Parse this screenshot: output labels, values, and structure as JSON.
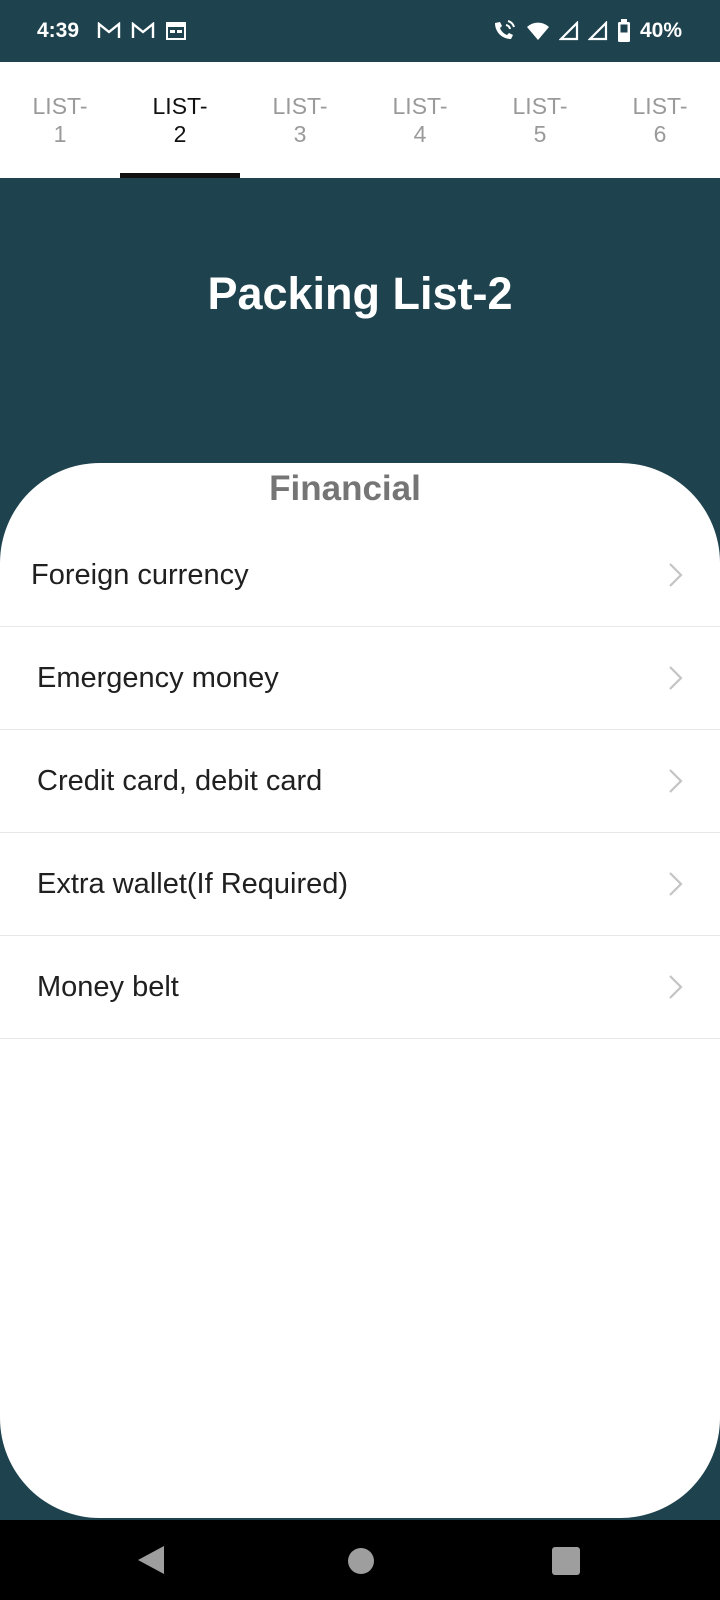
{
  "status_bar": {
    "time": "4:39",
    "notification_icons": [
      "gmail-icon",
      "gmail-icon",
      "calendar-icon"
    ],
    "system_icons": [
      "wifi-calling-icon",
      "wifi-icon",
      "signal-icon",
      "signal-icon",
      "battery-icon"
    ],
    "battery": "40%"
  },
  "tabs": [
    {
      "label": "LIST-1",
      "active": false
    },
    {
      "label": "LIST-2",
      "active": true
    },
    {
      "label": "LIST-3",
      "active": false
    },
    {
      "label": "LIST-4",
      "active": false
    },
    {
      "label": "LIST-5",
      "active": false
    },
    {
      "label": "LIST-6",
      "active": false
    }
  ],
  "header": {
    "title": "Packing List-2"
  },
  "section": {
    "title": "Financial",
    "items": [
      {
        "label": "Foreign currency"
      },
      {
        "label": "Emergency money"
      },
      {
        "label": "Credit card, debit card"
      },
      {
        "label": "Extra wallet(If Required)"
      },
      {
        "label": "Money belt"
      }
    ]
  },
  "nav_bar": {
    "buttons": [
      "back-icon",
      "home-icon",
      "recents-icon"
    ]
  },
  "colors": {
    "header_bg": "#1e434e",
    "active_tab": "#111111",
    "inactive_tab": "#9a9a9a",
    "section_title": "#757575"
  }
}
